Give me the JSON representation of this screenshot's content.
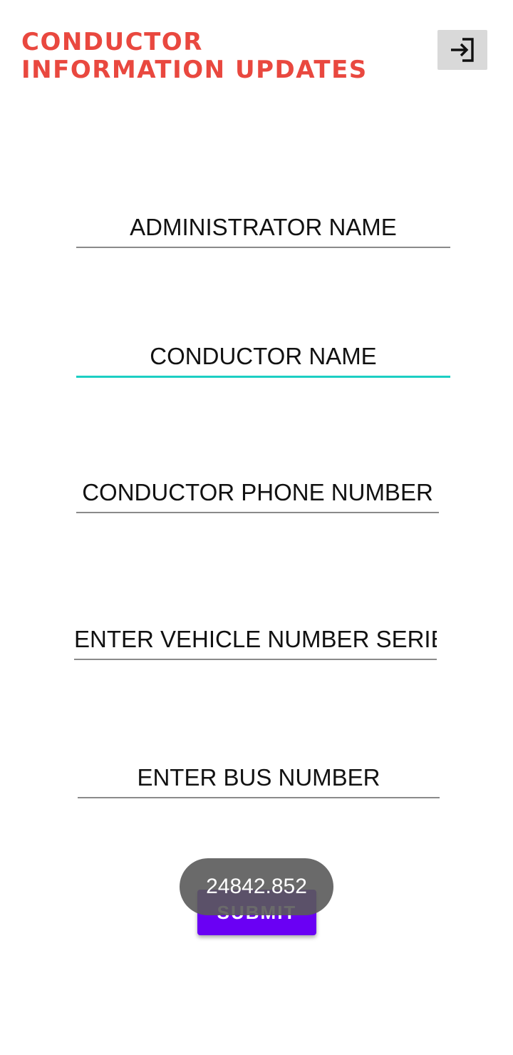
{
  "header": {
    "title_line1": "Conductor",
    "title_line2": "Information updates",
    "title_color": "#e9483f",
    "logout_icon": "login-arrow-icon"
  },
  "form": {
    "administrator_name": {
      "placeholder": "ADMINISTRATOR NAME"
    },
    "conductor_name": {
      "placeholder": "CONDUCTOR NAME",
      "focused": true
    },
    "conductor_phone": {
      "placeholder": "CONDUCTOR PHONE NUMBER"
    },
    "vehicle_number_series": {
      "placeholder": "ENTER VEHICLE NUMBER SERIE"
    },
    "bus_number": {
      "placeholder": "ENTER BUS NUMBER"
    },
    "submit_label": "SUBMIT",
    "submit_color": "#6a00f4",
    "focus_color": "#1ccfc3"
  },
  "toast": {
    "text": "24842.852"
  }
}
